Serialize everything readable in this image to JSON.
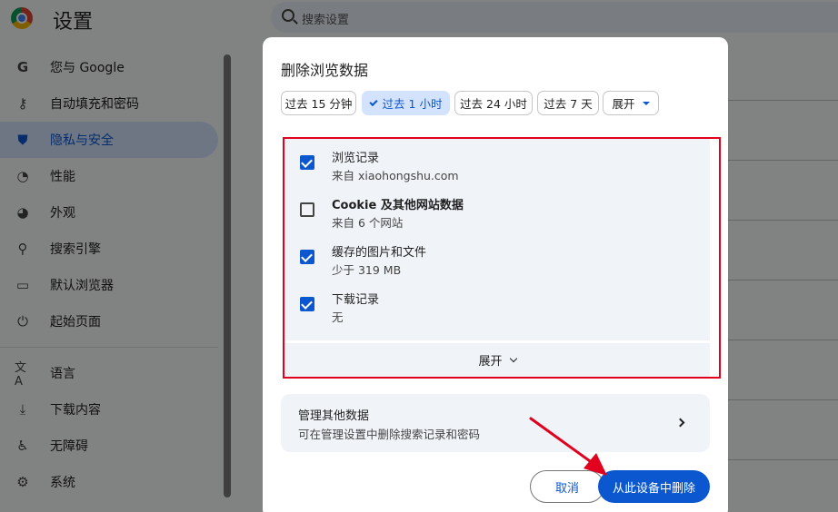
{
  "app": {
    "title": "设置"
  },
  "search": {
    "placeholder": "搜索设置"
  },
  "sidebar": {
    "items": [
      {
        "label": "您与 Google",
        "icon": "google-icon"
      },
      {
        "label": "自动填充和密码",
        "icon": "key-icon"
      },
      {
        "label": "隐私与安全",
        "icon": "shield-icon",
        "active": true
      },
      {
        "label": "性能",
        "icon": "gauge-icon"
      },
      {
        "label": "外观",
        "icon": "palette-icon"
      },
      {
        "label": "搜索引擎",
        "icon": "search-icon"
      },
      {
        "label": "默认浏览器",
        "icon": "browser-icon"
      },
      {
        "label": "起始页面",
        "icon": "power-icon"
      },
      {
        "label": "语言",
        "icon": "translate-icon"
      },
      {
        "label": "下载内容",
        "icon": "download-icon"
      },
      {
        "label": "无障碍",
        "icon": "accessibility-icon"
      },
      {
        "label": "系统",
        "icon": "wrench-icon"
      }
    ]
  },
  "dialog": {
    "title": "删除浏览数据",
    "time_ranges": [
      {
        "label": "过去 15 分钟",
        "selected": false
      },
      {
        "label": "过去 1 小时",
        "selected": true
      },
      {
        "label": "过去 24 小时",
        "selected": false
      },
      {
        "label": "过去 7 天",
        "selected": false
      },
      {
        "label": "展开",
        "dropdown": true
      }
    ],
    "items": [
      {
        "title": "浏览记录",
        "detail": "来自 xiaohongshu.com",
        "checked": true
      },
      {
        "title": "Cookie 及其他网站数据",
        "detail": "来自 6 个网站",
        "checked": false
      },
      {
        "title": "缓存的图片和文件",
        "detail": "少于 319 MB",
        "checked": true
      },
      {
        "title": "下载记录",
        "detail": "无",
        "checked": true
      }
    ],
    "expand_label": "展开",
    "manage": {
      "title": "管理其他数据",
      "subtitle": "可在管理设置中删除搜索记录和密码"
    },
    "cancel_label": "取消",
    "delete_label": "从此设备中删除"
  },
  "colors": {
    "accent": "#0b57d0",
    "annotation_red": "#e1001d"
  }
}
